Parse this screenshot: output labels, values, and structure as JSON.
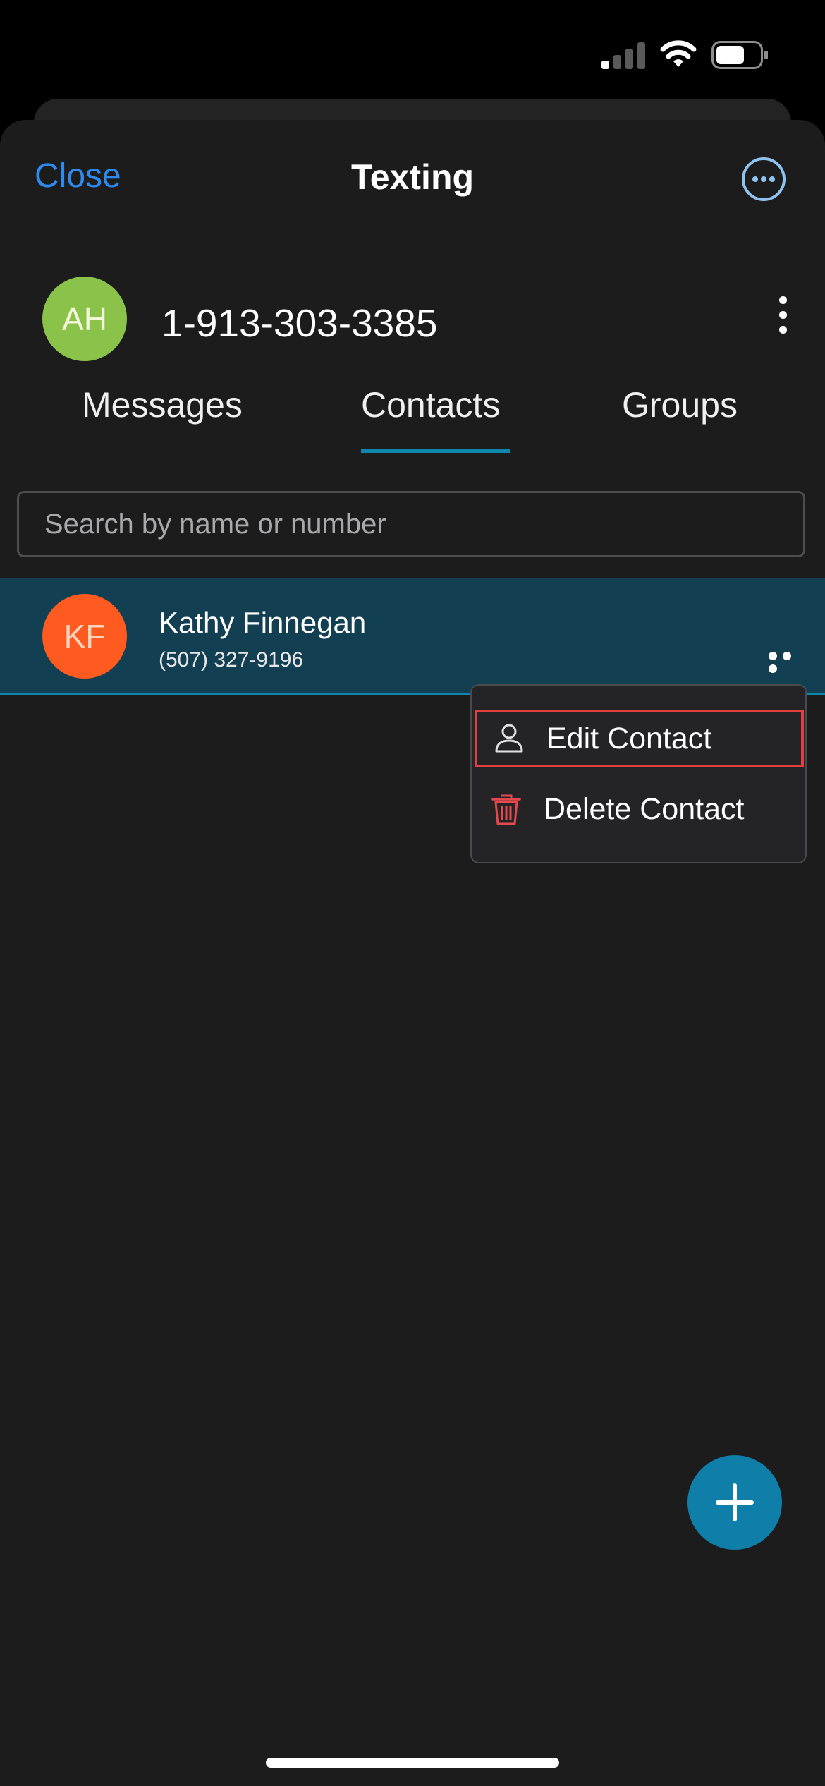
{
  "nav": {
    "close_label": "Close",
    "title": "Texting",
    "more_icon": "ellipsis-circle-icon"
  },
  "account": {
    "initials": "AH",
    "number": "1-913-303-3385",
    "avatar_color": "#8bc34a"
  },
  "tabs": [
    {
      "label": "Messages",
      "selected": false
    },
    {
      "label": "Contacts",
      "selected": true
    },
    {
      "label": "Groups",
      "selected": false
    }
  ],
  "search": {
    "placeholder": "Search by name or number",
    "value": ""
  },
  "contacts": [
    {
      "initials": "KF",
      "name": "Kathy Finnegan",
      "phone": "(507) 327-9196",
      "avatar_color": "#ff5a1f"
    }
  ],
  "context_menu": {
    "items": [
      {
        "label": "Edit Contact",
        "icon": "person-icon",
        "highlighted": true
      },
      {
        "label": "Delete Contact",
        "icon": "trash-icon",
        "highlighted": false
      }
    ]
  },
  "fab": {
    "icon": "plus-icon"
  },
  "colors": {
    "accent_blue": "#2d8bf0",
    "tab_underline": "#0f87ad",
    "selected_row": "#133f53",
    "highlight_border": "#e04040",
    "delete_red": "#e5484d"
  }
}
